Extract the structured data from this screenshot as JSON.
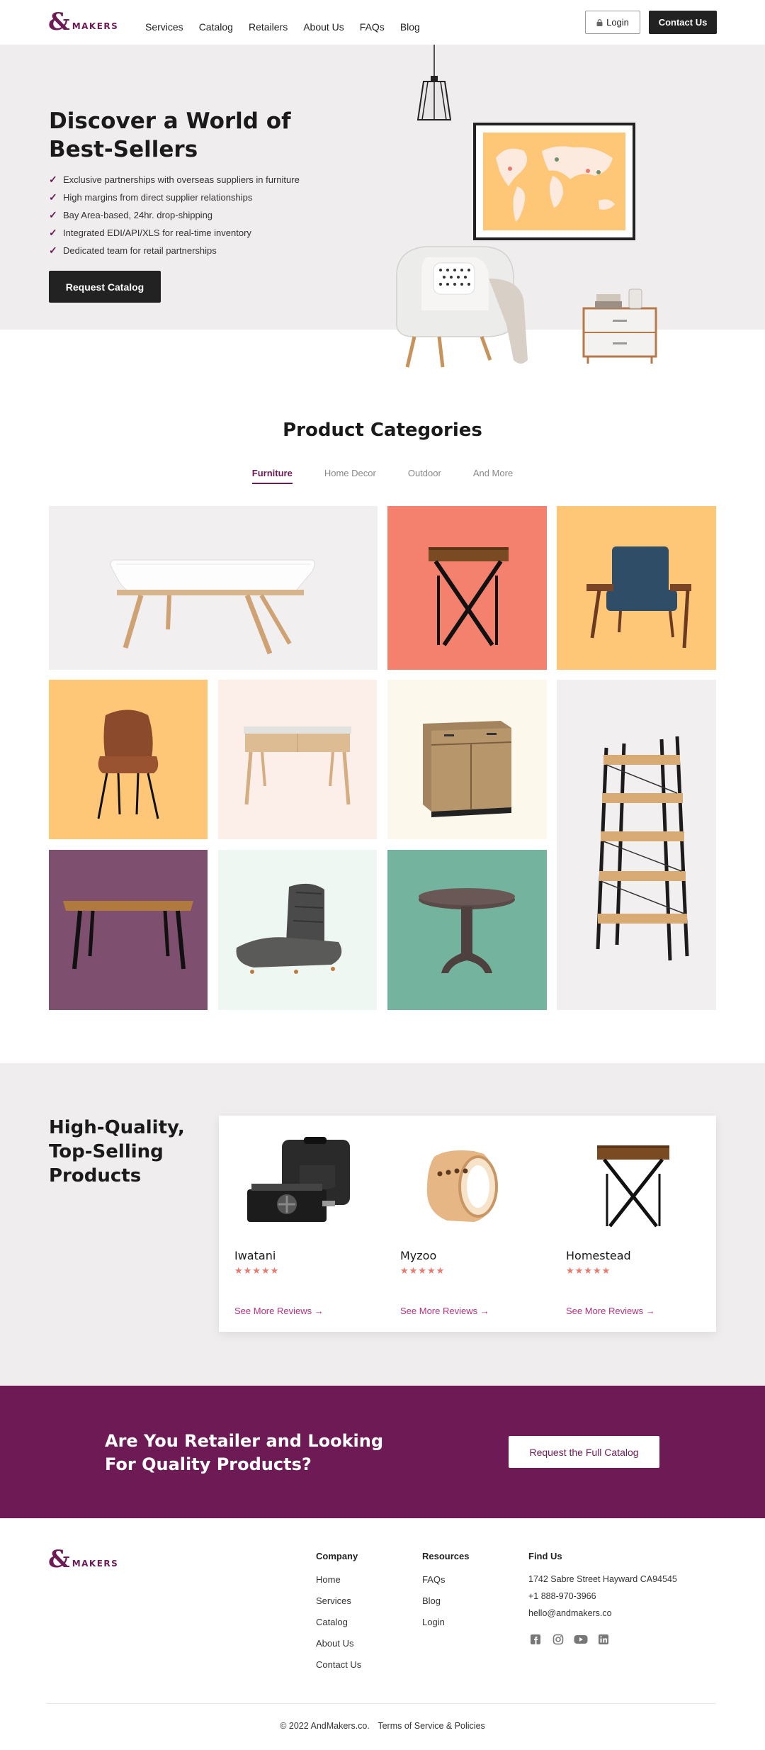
{
  "header": {
    "logo_amp": "&",
    "logo_word": "MAKERS",
    "nav": [
      "Services",
      "Catalog",
      "Retailers",
      "About Us",
      "FAQs",
      "Blog"
    ],
    "login_label": "Login",
    "contact_label": "Contact Us"
  },
  "hero": {
    "title": "Discover a World of Best-Sellers",
    "bullets": [
      "Exclusive partnerships with overseas suppliers in furniture",
      "High margins from direct supplier relationships",
      "Bay Area-based, 24hr. drop-shipping",
      "Integrated EDI/API/XLS for real-time inventory",
      "Dedicated team for retail partnerships"
    ],
    "cta_label": "Request Catalog"
  },
  "categories": {
    "title": "Product Categories",
    "tabs": [
      "Furniture",
      "Home Decor",
      "Outdoor",
      "And More"
    ],
    "active_tab": 0
  },
  "products": {
    "title": "High-Quality, Top-Selling Products",
    "items": [
      {
        "name": "Iwatani",
        "stars": "★★★★★",
        "link": "See More Reviews  →"
      },
      {
        "name": "Myzoo",
        "stars": "★★★★★",
        "link": "See More Reviews  →"
      },
      {
        "name": "Homestead",
        "stars": "★★★★★",
        "link": "See More Reviews  →"
      }
    ]
  },
  "cta": {
    "title": "Are You Retailer and Looking For Quality Products?",
    "button_label": "Request the Full Catalog"
  },
  "footer": {
    "company_title": "Company",
    "company_links": [
      "Home",
      "Services",
      "Catalog",
      "About Us",
      "Contact Us"
    ],
    "resources_title": "Resources",
    "resources_links": [
      "FAQs",
      "Blog",
      "Login"
    ],
    "find_title": "Find Us",
    "address": "1742 Sabre Street Hayward CA94545",
    "phone": "+1 888-970-3966",
    "email": "hello@andmakers.co",
    "social_icons": [
      "facebook-icon",
      "instagram-icon",
      "youtube-icon",
      "linkedin-icon"
    ],
    "copyright": "© 2022 AndMakers.co.",
    "terms": "Terms of Service & Policies"
  },
  "colors": {
    "brand": "#6e1a55",
    "star": "#f0776b",
    "link": "#b5317f",
    "tile_salmon": "#f4816d",
    "tile_yellow": "#fec677",
    "tile_blush": "#fcefea",
    "tile_cream": "#fdf8ec",
    "tile_grey": "#f1efef",
    "tile_plum": "#7f4f6f",
    "tile_mint": "#eff7f3",
    "tile_teal": "#74b49f"
  }
}
